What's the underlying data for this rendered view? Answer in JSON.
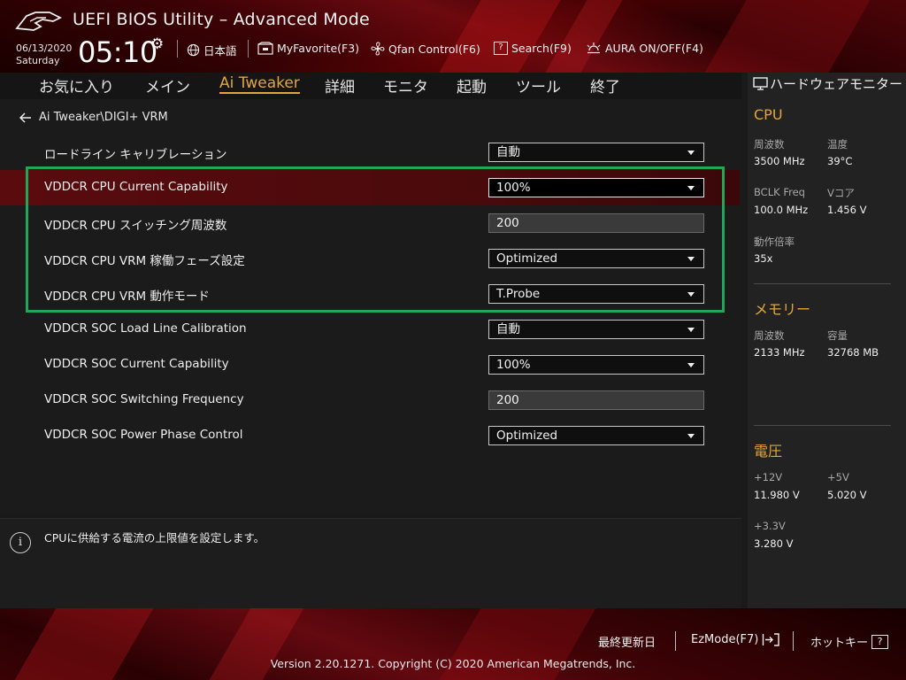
{
  "header": {
    "title": "UEFI BIOS Utility – Advanced Mode",
    "date": "06/13/2020",
    "day": "Saturday",
    "time": "05:10",
    "tools": {
      "language": "日本語",
      "myfavorite": "MyFavorite(F3)",
      "qfan": "Qfan Control(F6)",
      "search": "Search(F9)",
      "aura": "AURA ON/OFF(F4)"
    }
  },
  "nav": {
    "tabs": [
      "お気に入り",
      "メイン",
      "Ai Tweaker",
      "詳細",
      "モニタ",
      "起動",
      "ツール",
      "終了"
    ],
    "active": "Ai Tweaker"
  },
  "breadcrumb": "Ai Tweaker\\DIGI+ VRM",
  "settings": [
    {
      "label": "ロードライン キャリブレーション",
      "value": "自動"
    },
    {
      "label": "VDDCR CPU Current Capability",
      "value": "100%"
    },
    {
      "label": "VDDCR CPU スイッチング周波数",
      "value": "200"
    },
    {
      "label": "VDDCR CPU VRM 稼働フェーズ設定",
      "value": "Optimized"
    },
    {
      "label": "VDDCR CPU VRM 動作モード",
      "value": "T.Probe"
    },
    {
      "label": "VDDCR SOC Load Line Calibration",
      "value": "自動"
    },
    {
      "label": "VDDCR SOC Current Capability",
      "value": "100%"
    },
    {
      "label": "VDDCR SOC Switching Frequency",
      "value": "200"
    },
    {
      "label": "VDDCR SOC Power Phase Control",
      "value": "Optimized"
    }
  ],
  "help_text": "CPUに供給する電流の上限値を設定します。",
  "hw_monitor": {
    "title": "ハードウェアモニター",
    "cpu": {
      "heading": "CPU",
      "freq_label": "周波数",
      "freq": "3500 MHz",
      "temp_label": "温度",
      "temp": "39°C",
      "bclk_label": "BCLK Freq",
      "bclk": "100.0 MHz",
      "vcore_label": "Vコア",
      "vcore": "1.456 V",
      "ratio_label": "動作倍率",
      "ratio": "35x"
    },
    "memory": {
      "heading": "メモリー",
      "freq_label": "周波数",
      "freq": "2133 MHz",
      "cap_label": "容量",
      "cap": "32768 MB"
    },
    "voltage": {
      "heading": "電圧",
      "v12_label": "+12V",
      "v12": "11.980 V",
      "v5_label": "+5V",
      "v5": "5.020 V",
      "v33_label": "+3.3V",
      "v33": "3.280 V"
    }
  },
  "footer": {
    "last_modified": "最終更新日",
    "ezmode": "EzMode(F7)",
    "hotkeys": "ホットキー",
    "hotkey_glyph": "?",
    "copyright": "Version 2.20.1271. Copyright (C) 2020 American Megatrends, Inc."
  },
  "colors": {
    "accent": "#e3a63a",
    "selected_row": "#5a0b0e",
    "highlight_box": "#21a65a"
  }
}
